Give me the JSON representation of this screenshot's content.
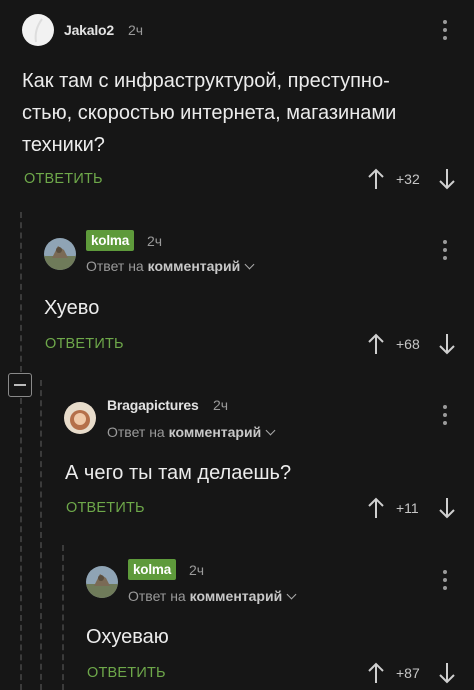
{
  "comments": [
    {
      "author": "Jakalo2",
      "time": "2ч",
      "text_lines": [
        "Как там с инфраструктурой, преступно-",
        "стью, скоростью интернета, магазинами",
        "техники?"
      ],
      "reply": "ОТВЕТИТЬ",
      "score": "+32"
    },
    {
      "author": "kolma",
      "time": "2ч",
      "reply_to_prefix": "Ответ на",
      "reply_to_target": "комментарий",
      "text_lines": [
        "Хуево"
      ],
      "reply": "ОТВЕТИТЬ",
      "score": "+68"
    },
    {
      "author": "Bragapictures",
      "time": "2ч",
      "reply_to_prefix": "Ответ на",
      "reply_to_target": "комментарий",
      "text_lines": [
        "А чего ты там делаешь?"
      ],
      "reply": "ОТВЕТИТЬ",
      "score": "+11"
    },
    {
      "author": "kolma",
      "time": "2ч",
      "reply_to_prefix": "Ответ на",
      "reply_to_target": "комментарий",
      "text_lines": [
        "Охуеваю"
      ],
      "reply": "ОТВЕТИТЬ",
      "score": "+87"
    }
  ],
  "colors": {
    "accent": "#6ea84a",
    "badge": "#5e9a3b",
    "background": "#161616"
  }
}
